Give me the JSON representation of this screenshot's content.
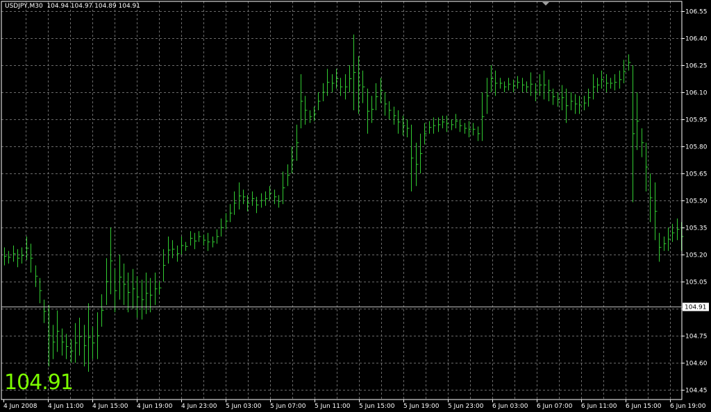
{
  "header": {
    "symbol": "USDJPY,M30",
    "ohlc_text": "104.94 104.97 104.89 104.91"
  },
  "big_price": "104.91",
  "colors": {
    "background": "#000000",
    "grid": "#6b6b6b",
    "bar": "#32cd32",
    "text": "#ffffff",
    "big_price": "#7cfc00",
    "current_line": "#c0c0c0",
    "current_label_bg": "#ffffff"
  },
  "chart_data": {
    "type": "bar",
    "symbol": "USDJPY",
    "timeframe": "M30",
    "ylim": [
      104.42,
      106.6
    ],
    "y_ticks": [
      "106.55",
      "106.40",
      "106.25",
      "106.10",
      "105.95",
      "105.80",
      "105.65",
      "105.50",
      "105.35",
      "105.20",
      "105.05",
      "104.90",
      "104.75",
      "104.60",
      "104.45"
    ],
    "x_ticks": [
      "4 Jun 2008",
      "4 Jun 11:00",
      "4 Jun 15:00",
      "4 Jun 19:00",
      "4 Jun 23:00",
      "5 Jun 03:00",
      "5 Jun 07:00",
      "5 Jun 11:00",
      "5 Jun 15:00",
      "5 Jun 19:00",
      "5 Jun 23:00",
      "6 Jun 03:00",
      "6 Jun 07:00",
      "6 Jun 11:00",
      "6 Jun 15:00",
      "6 Jun 19:00"
    ],
    "current_price": "104.91",
    "grid": true,
    "bars_high_low": [
      [
        105.24,
        105.14
      ],
      [
        105.22,
        105.15
      ],
      [
        105.25,
        105.16
      ],
      [
        105.23,
        105.13
      ],
      [
        105.24,
        105.15
      ],
      [
        105.3,
        105.17
      ],
      [
        105.26,
        105.1
      ],
      [
        105.14,
        105.02
      ],
      [
        105.07,
        104.93
      ],
      [
        104.95,
        104.82
      ],
      [
        104.92,
        104.58
      ],
      [
        104.81,
        104.62
      ],
      [
        104.89,
        104.66
      ],
      [
        104.79,
        104.64
      ],
      [
        104.76,
        104.62
      ],
      [
        104.73,
        104.6
      ],
      [
        104.82,
        104.6
      ],
      [
        104.85,
        104.64
      ],
      [
        104.81,
        104.58
      ],
      [
        104.93,
        104.55
      ],
      [
        104.8,
        104.62
      ],
      [
        104.88,
        104.62
      ],
      [
        104.98,
        104.8
      ],
      [
        105.18,
        104.92
      ],
      [
        105.35,
        104.98
      ],
      [
        105.12,
        104.88
      ],
      [
        105.2,
        104.95
      ],
      [
        105.15,
        104.92
      ],
      [
        105.1,
        104.88
      ],
      [
        105.12,
        104.9
      ],
      [
        105.08,
        104.85
      ],
      [
        105.06,
        104.84
      ],
      [
        105.1,
        104.87
      ],
      [
        105.07,
        104.88
      ],
      [
        105.1,
        104.92
      ],
      [
        105.05,
        104.98
      ],
      [
        105.23,
        105.05
      ],
      [
        105.3,
        105.15
      ],
      [
        105.28,
        105.18
      ],
      [
        105.25,
        105.16
      ],
      [
        105.3,
        105.2
      ],
      [
        105.27,
        105.22
      ],
      [
        105.33,
        105.25
      ],
      [
        105.32,
        105.23
      ],
      [
        105.33,
        105.27
      ],
      [
        105.31,
        105.25
      ],
      [
        105.32,
        105.22
      ],
      [
        105.3,
        105.24
      ],
      [
        105.34,
        105.26
      ],
      [
        105.4,
        105.3
      ],
      [
        105.43,
        105.34
      ],
      [
        105.48,
        105.38
      ],
      [
        105.55,
        105.42
      ],
      [
        105.6,
        105.45
      ],
      [
        105.56,
        105.48
      ],
      [
        105.53,
        105.44
      ],
      [
        105.55,
        105.47
      ],
      [
        105.52,
        105.43
      ],
      [
        105.54,
        105.46
      ],
      [
        105.55,
        105.47
      ],
      [
        105.58,
        105.5
      ],
      [
        105.56,
        105.48
      ],
      [
        105.53,
        105.46
      ],
      [
        105.66,
        105.48
      ],
      [
        105.7,
        105.58
      ],
      [
        105.8,
        105.65
      ],
      [
        105.92,
        105.72
      ],
      [
        106.2,
        105.9
      ],
      [
        106.08,
        105.92
      ],
      [
        106.0,
        105.93
      ],
      [
        106.02,
        105.94
      ],
      [
        106.1,
        106.0
      ],
      [
        106.15,
        106.05
      ],
      [
        106.23,
        106.08
      ],
      [
        106.2,
        106.1
      ],
      [
        106.23,
        106.12
      ],
      [
        106.18,
        106.08
      ],
      [
        106.2,
        106.06
      ],
      [
        106.25,
        106.1
      ],
      [
        106.42,
        106.0
      ],
      [
        106.3,
        105.98
      ],
      [
        106.22,
        106.04
      ],
      [
        106.12,
        105.87
      ],
      [
        106.08,
        105.93
      ],
      [
        106.15,
        106.0
      ],
      [
        106.18,
        106.04
      ],
      [
        106.1,
        105.97
      ],
      [
        106.05,
        105.95
      ],
      [
        106.02,
        105.92
      ],
      [
        106.0,
        105.87
      ],
      [
        105.97,
        105.86
      ],
      [
        105.95,
        105.85
      ],
      [
        105.92,
        105.55
      ],
      [
        105.82,
        105.58
      ],
      [
        105.87,
        105.65
      ],
      [
        105.93,
        105.81
      ],
      [
        105.94,
        105.87
      ],
      [
        105.96,
        105.87
      ],
      [
        105.96,
        105.88
      ],
      [
        105.97,
        105.9
      ],
      [
        105.97,
        105.88
      ],
      [
        105.95,
        105.89
      ],
      [
        105.98,
        105.9
      ],
      [
        105.95,
        105.88
      ],
      [
        105.93,
        105.87
      ],
      [
        105.94,
        105.85
      ],
      [
        105.93,
        105.86
      ],
      [
        105.91,
        105.83
      ],
      [
        106.1,
        105.83
      ],
      [
        106.18,
        105.98
      ],
      [
        106.25,
        106.1
      ],
      [
        106.22,
        106.08
      ],
      [
        106.18,
        106.12
      ],
      [
        106.16,
        106.1
      ],
      [
        106.18,
        106.11
      ],
      [
        106.17,
        106.1
      ],
      [
        106.19,
        106.12
      ],
      [
        106.18,
        106.1
      ],
      [
        106.16,
        106.1
      ],
      [
        106.21,
        106.08
      ],
      [
        106.15,
        106.05
      ],
      [
        106.2,
        106.08
      ],
      [
        106.22,
        106.06
      ],
      [
        106.17,
        106.05
      ],
      [
        106.12,
        106.03
      ],
      [
        106.1,
        106.02
      ],
      [
        106.14,
        106.0
      ],
      [
        106.12,
        105.93
      ],
      [
        106.1,
        106.0
      ],
      [
        106.09,
        105.98
      ],
      [
        106.08,
        105.98
      ],
      [
        106.08,
        106.0
      ],
      [
        106.12,
        106.02
      ],
      [
        106.2,
        106.06
      ],
      [
        106.18,
        106.1
      ],
      [
        106.22,
        106.12
      ],
      [
        106.2,
        106.1
      ],
      [
        106.18,
        106.12
      ],
      [
        106.2,
        106.11
      ],
      [
        106.22,
        106.12
      ],
      [
        106.28,
        106.15
      ],
      [
        106.31,
        106.22
      ],
      [
        106.25,
        105.49
      ],
      [
        106.1,
        105.78
      ],
      [
        105.9,
        105.74
      ],
      [
        105.82,
        105.55
      ],
      [
        105.65,
        105.38
      ],
      [
        105.6,
        105.28
      ],
      [
        105.32,
        105.16
      ],
      [
        105.3,
        105.22
      ],
      [
        105.35,
        105.22
      ],
      [
        105.37,
        105.27
      ],
      [
        105.4,
        105.28
      ],
      [
        105.38,
        105.22
      ]
    ]
  }
}
